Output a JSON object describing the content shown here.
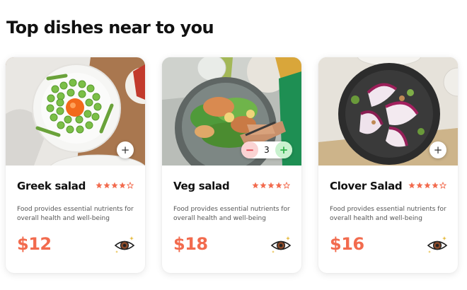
{
  "section": {
    "title": "Top dishes near to you"
  },
  "colors": {
    "accent": "#f26b4e",
    "star": "#f26b4e",
    "stepper_minus": "#e0454f",
    "stepper_plus": "#2fb34a"
  },
  "icons": {
    "add": "plus-icon",
    "view": "eye-icon",
    "rating": "star-icon"
  },
  "cards": [
    {
      "name": "Greek salad",
      "rating": 4,
      "rating_max": 5,
      "description": "Food provides essential nutrients for overall health and well-being",
      "price": "$12",
      "add_label": "+"
    },
    {
      "name": "Veg salad",
      "rating": 4,
      "rating_max": 5,
      "description": "Food provides essential nutrients for overall health and well-being",
      "price": "$18",
      "stepper": {
        "minus": "−",
        "quantity": "3",
        "plus": "+"
      }
    },
    {
      "name": "Clover Salad",
      "rating": 4,
      "rating_max": 5,
      "description": "Food provides essential nutrients for overall health and well-being",
      "price": "$16",
      "add_label": "+"
    }
  ]
}
